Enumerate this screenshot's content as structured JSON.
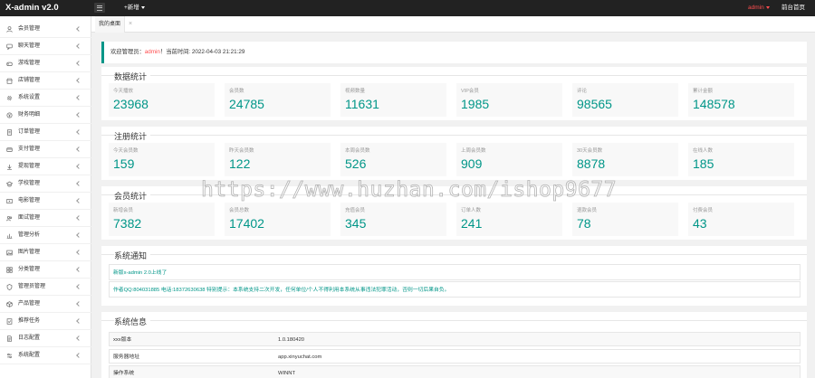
{
  "topbar": {
    "logo": "X-admin v2.0",
    "add_new": "+新增",
    "user": "admin",
    "home": "前台首页"
  },
  "sidebar": {
    "items": [
      {
        "label": "会员管理",
        "icon": "user-icon"
      },
      {
        "label": "聊天管理",
        "icon": "chat-icon"
      },
      {
        "label": "游戏管理",
        "icon": "game-icon"
      },
      {
        "label": "店铺管理",
        "icon": "store-icon"
      },
      {
        "label": "系统设置",
        "icon": "gear-icon"
      },
      {
        "label": "财务明细",
        "icon": "finance-icon"
      },
      {
        "label": "订单管理",
        "icon": "order-icon"
      },
      {
        "label": "支付管理",
        "icon": "pay-icon"
      },
      {
        "label": "提现管理",
        "icon": "withdraw-icon"
      },
      {
        "label": "学校管理",
        "icon": "school-icon"
      },
      {
        "label": "电影管理",
        "icon": "movie-icon"
      },
      {
        "label": "面试管理",
        "icon": "interview-icon"
      },
      {
        "label": "管理分析",
        "icon": "chart-icon"
      },
      {
        "label": "图片管理",
        "icon": "image-icon"
      },
      {
        "label": "分类管理",
        "icon": "category-icon"
      },
      {
        "label": "管理员管理",
        "icon": "admin-icon"
      },
      {
        "label": "产品管理",
        "icon": "product-icon"
      },
      {
        "label": "推荐任务",
        "icon": "task-icon"
      },
      {
        "label": "日志配置",
        "icon": "log-icon"
      },
      {
        "label": "系统配置",
        "icon": "config-icon"
      }
    ]
  },
  "tabs": {
    "active": "我的桌面",
    "close": "×"
  },
  "welcome": {
    "prefix": "欢迎管理员：",
    "admin": "admin",
    "suffix": "！当前时间: 2022-04-03 21:21:29"
  },
  "data_stats": {
    "title": "数据统计",
    "items": [
      {
        "label": "今天播放",
        "value": "23968"
      },
      {
        "label": "会员数",
        "value": "24785"
      },
      {
        "label": "视频数量",
        "value": "11631"
      },
      {
        "label": "VIP会员",
        "value": "1985"
      },
      {
        "label": "评论",
        "value": "98565"
      },
      {
        "label": "累计金额",
        "value": "148578"
      }
    ]
  },
  "reg_stats": {
    "title": "注册统计",
    "items": [
      {
        "label": "今天会员数",
        "value": "159"
      },
      {
        "label": "昨天会员数",
        "value": "122"
      },
      {
        "label": "本周会员数",
        "value": "526"
      },
      {
        "label": "上周会员数",
        "value": "909"
      },
      {
        "label": "30天会员数",
        "value": "8878"
      },
      {
        "label": "在线人数",
        "value": "185"
      }
    ]
  },
  "member_stats": {
    "title": "会员统计",
    "items": [
      {
        "label": "新增会员",
        "value": "7382"
      },
      {
        "label": "会员总数",
        "value": "17402"
      },
      {
        "label": "充值会员",
        "value": "345"
      },
      {
        "label": "订单人数",
        "value": "241"
      },
      {
        "label": "退款会员",
        "value": "78"
      },
      {
        "label": "付费会员",
        "value": "43"
      }
    ]
  },
  "notice": {
    "title": "系统通知",
    "line1": "新版x-admin 2.0上线了",
    "line2": "作者QQ:804031885 电话:18372630638 特别提示：本系统支持二次开发，任何单位/个人不得利用本系统从事违法犯罪活动，否则一切后果自负。"
  },
  "sysinfo": {
    "title": "系统信息",
    "rows": [
      {
        "k": "xxx版本",
        "v": "1.0.180420"
      },
      {
        "k": "服务器地址",
        "v": "app.xinyuchat.com"
      },
      {
        "k": "操作系统",
        "v": "WINNT"
      }
    ]
  },
  "watermark": "https://www.huzhan.com/ishop9677",
  "colors": {
    "accent": "#009688",
    "topbar": "#222222",
    "user": "#ff4d4f"
  }
}
